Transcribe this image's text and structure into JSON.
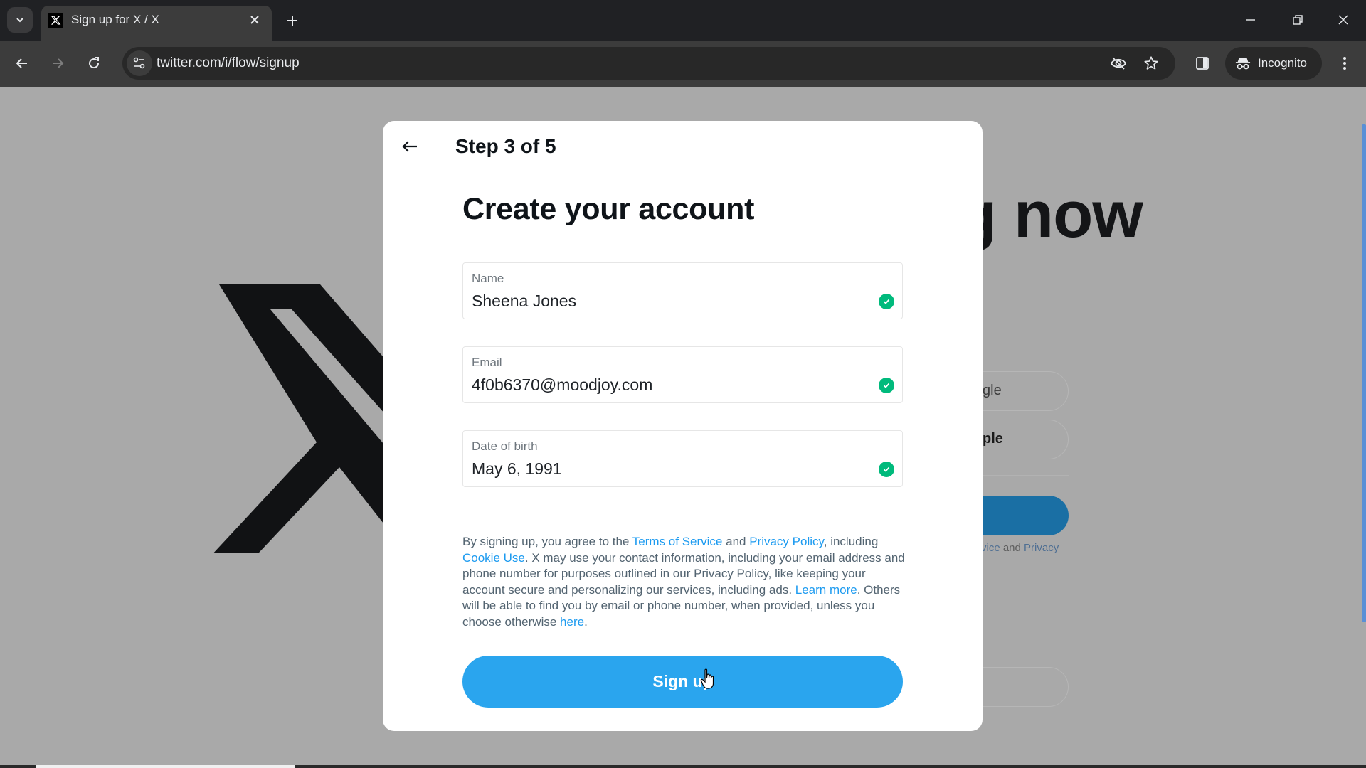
{
  "browser": {
    "tab_title": "Sign up for X / X",
    "url": "twitter.com/i/flow/signup",
    "incognito_label": "Incognito",
    "icons": {
      "tab_search": "chevron-down-icon",
      "favicon": "x-logo-icon",
      "tab_close": "close-icon",
      "new_tab": "plus-icon",
      "minimize": "minimize-icon",
      "restore": "restore-icon",
      "close_window": "close-icon",
      "back": "arrow-left-icon",
      "forward": "arrow-right-icon",
      "reload": "reload-icon",
      "site_info": "tune-icon",
      "tracking_protection": "eye-off-icon",
      "bookmark": "star-icon",
      "side_panel": "side-panel-icon",
      "incognito": "incognito-icon",
      "menu": "more-vertical-icon"
    }
  },
  "background_page": {
    "headline_visible": "ening now",
    "pill_1_visible": "gle",
    "pill_2_visible": "ple",
    "legal_visible_prefix": "rvice",
    "legal_visible_and": " and ",
    "legal_visible_link": "Privacy"
  },
  "modal": {
    "step": "Step 3 of 5",
    "title": "Create your account",
    "fields": [
      {
        "label": "Name",
        "value": "Sheena Jones",
        "valid": true
      },
      {
        "label": "Email",
        "value": "4f0b6370@moodjoy.com",
        "valid": true
      },
      {
        "label": "Date of birth",
        "value": "May 6, 1991",
        "valid": true
      }
    ],
    "legal": {
      "t1": "By signing up, you agree to the ",
      "terms": "Terms of Service",
      "t2": " and ",
      "privacy": "Privacy Policy",
      "t3": ", including ",
      "cookie": "Cookie Use",
      "t4": ". X may use your contact information, including your email address and phone number for purposes outlined in our Privacy Policy, like keeping your account secure and personalizing our services, including ads. ",
      "learn_more": "Learn more",
      "t5": ". Others will be able to find you by email or phone number, when provided, unless you choose otherwise ",
      "here": "here",
      "t6": "."
    },
    "signup_label": "Sign up"
  },
  "colors": {
    "accent": "#1d9bf0",
    "button": "#2aa5ee",
    "valid": "#00ba7c"
  }
}
